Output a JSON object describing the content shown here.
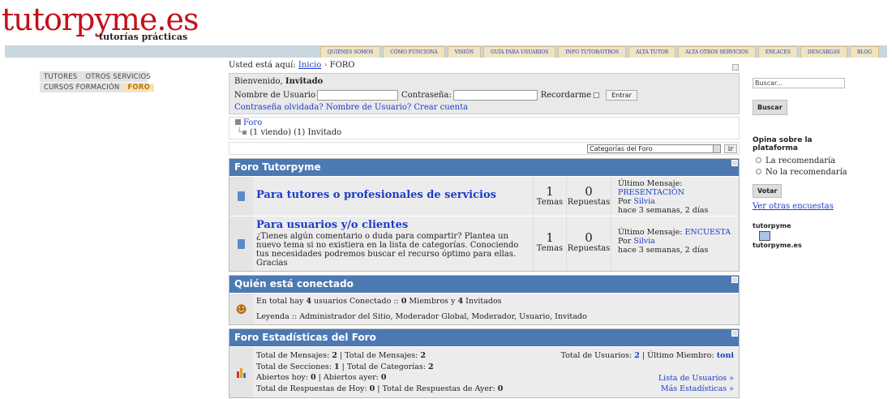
{
  "logo": {
    "title": "tutorpyme.es",
    "subtitle": "tutorías prácticas"
  },
  "topnav": [
    "QUIÉNES SOMOS",
    "CÓMO FUNCIONA",
    "VISIÓN",
    "GUÍA PARA USUARIOS",
    "INFO TUTOR/OTROS",
    "ALTA TUTOR",
    "ALTA OTROS SERVICIOS",
    "ENLACES",
    "DESCARGAS",
    "BLOG"
  ],
  "leftmenu": {
    "row1": [
      "TUTORES",
      "OTROS SERVICIOS"
    ],
    "row2": [
      "CURSOS FORMACIÓN",
      "FORO"
    ]
  },
  "breadcrumb": {
    "prefix": "Usted está aquí:",
    "home": "Inicio",
    "sep": "›",
    "current": "FORO"
  },
  "login": {
    "welcome_prefix": "Bienvenido,",
    "welcome_user": "Invitado",
    "user_label": "Nombre de Usuario",
    "pass_label": "Contraseña:",
    "remember_label": "Recordarme",
    "submit": "Entrar",
    "forgot": "Contraseña olvidada?",
    "forgot_user": "Nombre de Usuario?",
    "create": "Crear cuenta"
  },
  "tree": {
    "root": "Foro",
    "viewing": "(1 viendo) (1) Invitado"
  },
  "jump": {
    "selected": "Categorías del Foro",
    "go": "ir"
  },
  "forum": {
    "title": "Foro Tutorpyme",
    "rows": [
      {
        "name": "Para tutores o profesionales de servicios",
        "desc": "",
        "temas": "1",
        "temas_label": "Temas",
        "resp": "0",
        "resp_label": "Repuestas",
        "last_label": "Último Mensaje:",
        "last_topic": "PRESENTACIÓN",
        "by_label": "Por",
        "by": "Silvia",
        "when": "hace 3 semanas, 2 días"
      },
      {
        "name": "Para usuarios y/o clientes",
        "desc": "¿Tienes algún comentario o duda para compartir? Plantea un nuevo tema si no existiera en la lista de categorías. Conociendo tus necesidades podremos buscar el recurso óptimo para ellas. Gracias",
        "temas": "1",
        "temas_label": "Temas",
        "resp": "0",
        "resp_label": "Repuestas",
        "last_label": "Último Mensaje:",
        "last_topic": "ENCUESTA",
        "by_label": "Por",
        "by": "Silvia",
        "when": "hace 3 semanas, 2 días"
      }
    ]
  },
  "online": {
    "title": "Quién está conectado",
    "line1_a": "En total hay",
    "users": "4",
    "line1_b": "usuarios Conectado ::",
    "members": "0",
    "line1_c": "Miembros y",
    "guests": "4",
    "line1_d": "Invitados",
    "legend": "Leyenda ::  Administrador del Sitio,  Moderador Global,  Moderador,  Usuario,  Invitado"
  },
  "stats": {
    "title": "Foro Estadísticas del Foro",
    "l1a": "Total de Mensajes:",
    "v1a": "2",
    "l1b": "| Total de Mensajes:",
    "v1b": "2",
    "l2a": "Total de Secciones:",
    "v2a": "1",
    "l2b": "| Total de Categorías:",
    "v2b": "2",
    "l3a": "Abiertos hoy:",
    "v3a": "0",
    "l3b": "| Abiertos ayer:",
    "v3b": "0",
    "l4a": "Total de Respuestas de Hoy:",
    "v4a": "0",
    "l4b": "| Total de Respuestas de Ayer:",
    "v4b": "0",
    "users_label": "Total de Usuarios:",
    "users": "2",
    "member_label": "| Último Miembro:",
    "member": "toni",
    "link_users": "Lista de Usuarios »",
    "link_more": "Más Estadísticas »"
  },
  "sidebar": {
    "search_placeholder": "Buscar...",
    "search_btn": "Buscar",
    "poll_title": "Opina sobre la plataforma",
    "opt1": "La recomendaría",
    "opt2": "No la recomendaría",
    "vote": "Votar",
    "other": "Ver otras encuestas",
    "mini_logo1": "tutorpyme",
    "mini_logo2": "tutorpyme.es"
  }
}
